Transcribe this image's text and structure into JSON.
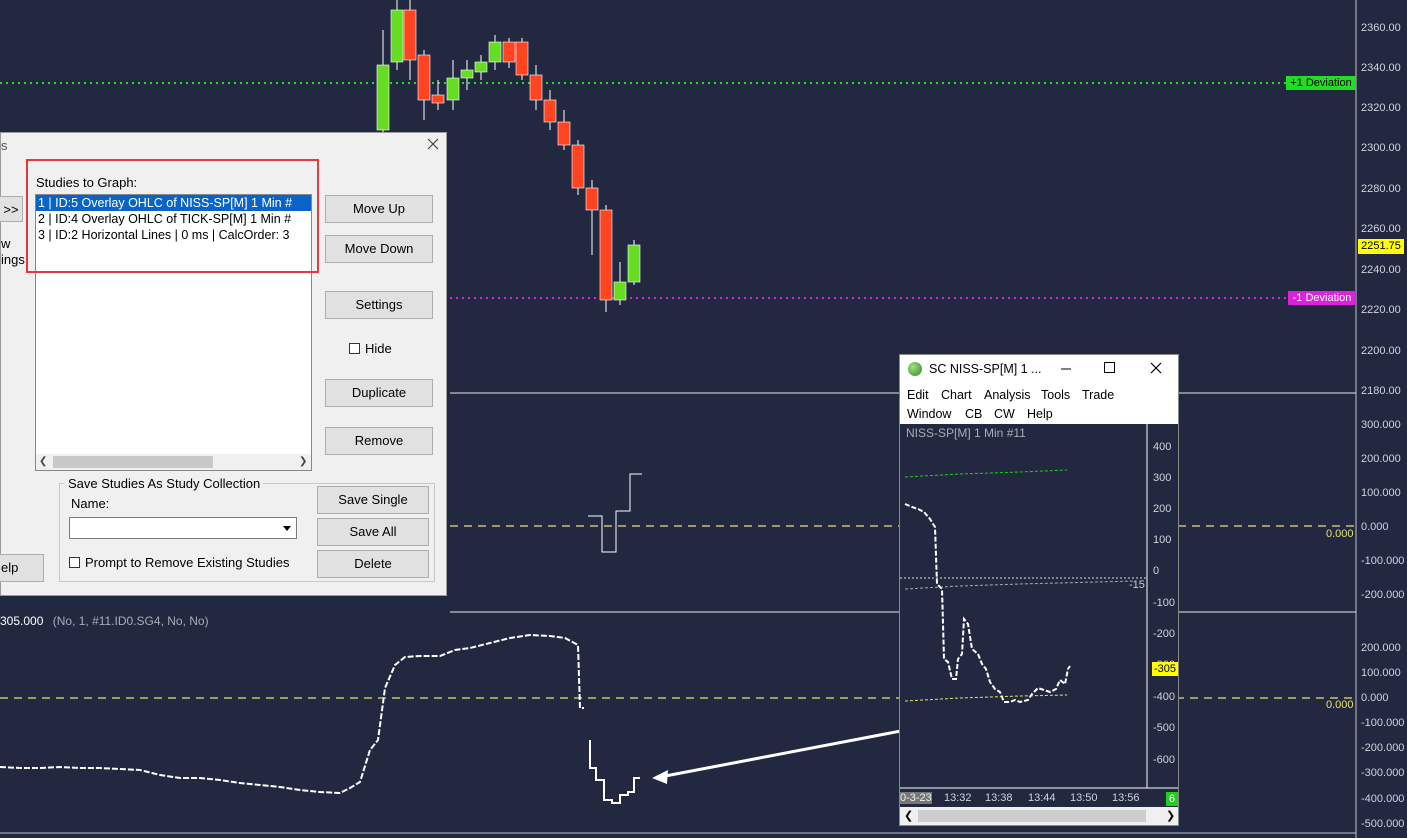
{
  "main_chart": {
    "price_axis": [
      "2360.00",
      "2340.00",
      "2320.00",
      "2300.00",
      "2280.00",
      "2260.00",
      "2240.00",
      "2220.00",
      "2200.00",
      "2180.00"
    ],
    "current_price": "2251.75",
    "plus_deviation_label": "+1 Deviation",
    "minus_deviation_label": "-1 Deviation",
    "colors": {
      "background": "#222840",
      "up_candle": "#66dd22",
      "down_candle": "#ff4422",
      "plus_dev": "#22dd22",
      "minus_dev": "#dd22dd",
      "price_badge": "#ffff00"
    }
  },
  "tick_panel": {
    "axis": [
      "300.000",
      "200.000",
      "100.000",
      "0.000",
      "-100.000",
      "-200.000"
    ],
    "zero_label": "0.000"
  },
  "niss_panel": {
    "header": "305.000",
    "header_info": "(No, 1, #11.ID0.SG4, No, No)",
    "axis": [
      "200.000",
      "100.000",
      "0.000",
      "-100.000",
      "-200.000",
      "-300.000",
      "-400.000",
      "-500.000"
    ],
    "zero_label": "0.000"
  },
  "dialog": {
    "title_fragment": "s",
    "arrow_button": ">>",
    "left_text_1": "w",
    "left_text_2": "ings",
    "help_fragment": "elp",
    "studies_label": "Studies to Graph:",
    "studies": [
      "1 | ID:5  Overlay OHLC of NISS-SP[M]  1 Min  #",
      "2 | ID:4  Overlay OHLC of TICK-SP[M]  1 Min  #",
      "3 | ID:2  Horizontal Lines | 0 ms | CalcOrder: 3"
    ],
    "buttons": {
      "move_up": "Move Up",
      "move_down": "Move Down",
      "settings": "Settings",
      "hide": "Hide",
      "duplicate": "Duplicate",
      "remove": "Remove"
    },
    "collection": {
      "group_label": "Save Studies As Study Collection",
      "name_label": "Name:",
      "name_value": "",
      "prompt_label": "Prompt to Remove Existing Studies",
      "save_single": "Save Single",
      "save_all": "Save All",
      "delete": "Delete"
    }
  },
  "mini_window": {
    "title": "SC NISS-SP[M]  1 ...",
    "menu_row1": [
      "Edit",
      "Chart",
      "Analysis",
      "Tools",
      "Trade"
    ],
    "menu_row2": [
      "Window",
      "CB",
      "CW",
      "Help"
    ],
    "chart_label": "NISS-SP[M]  1 Min   #11",
    "axis": [
      "400",
      "300",
      "200",
      "100",
      "0",
      "-100",
      "-200",
      "-300",
      "-400",
      "-500",
      "-600"
    ],
    "marker_minus15": "-15",
    "value_badge": "-305",
    "time_labels": [
      "0-3-23",
      "13:32",
      "13:38",
      "13:44",
      "13:50",
      "13:56"
    ],
    "green_badge": "6"
  }
}
